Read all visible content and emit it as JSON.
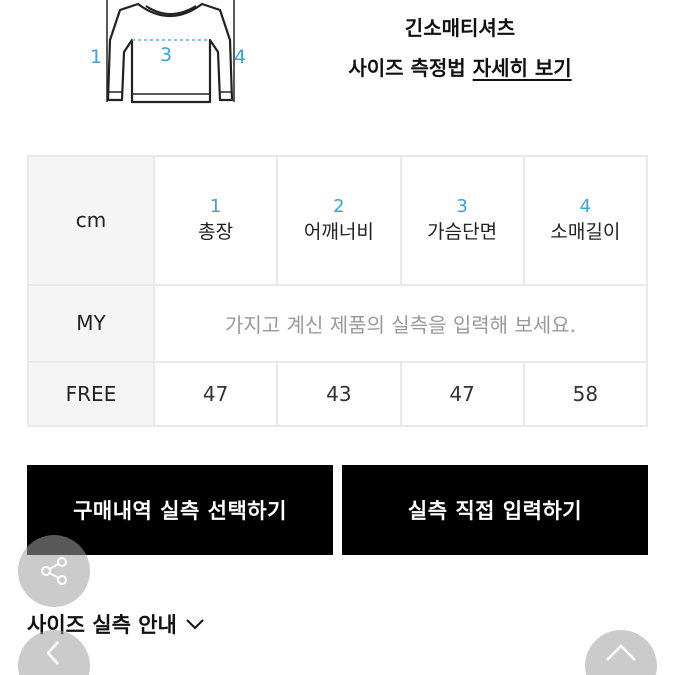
{
  "product": {
    "name": "긴소매티셔츠",
    "guide_prefix": "사이즈 측정법",
    "guide_link": "자세히 보기"
  },
  "diagram": {
    "labels": [
      "1",
      "3",
      "4"
    ]
  },
  "table": {
    "unit_header": "cm",
    "columns": [
      {
        "num": "1",
        "name": "총장"
      },
      {
        "num": "2",
        "name": "어깨너비"
      },
      {
        "num": "3",
        "name": "가슴단면"
      },
      {
        "num": "4",
        "name": "소매길이"
      }
    ],
    "my_row": {
      "label": "MY",
      "hint": "가지고 계신 제품의 실측을 입력해 보세요."
    },
    "free_row": {
      "label": "FREE",
      "values": [
        "47",
        "43",
        "47",
        "58"
      ]
    }
  },
  "buttons": {
    "purchase_history": "구매내역 실측 선택하기",
    "direct_input": "실측 직접 입력하기"
  },
  "size_info": {
    "label": "사이즈 실측 안내"
  },
  "colors": {
    "accent": "#3aa3d8",
    "button_bg": "#000000",
    "header_bg": "#f5f5f5"
  },
  "icons": {
    "share": "share-icon",
    "chevron": "chevron-down-icon",
    "prev": "chevron-left-icon",
    "top": "chevron-up-icon"
  }
}
